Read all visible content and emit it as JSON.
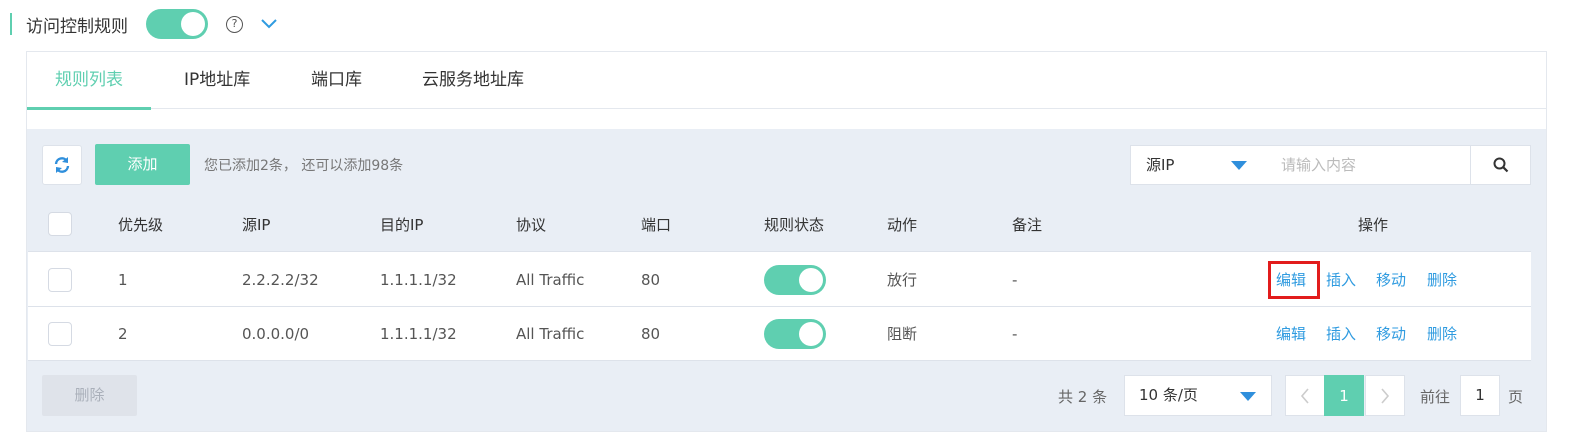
{
  "header": {
    "title": "访问控制规则",
    "enabled": true,
    "help_icon": "question-circle-icon",
    "expand_icon": "chevron-down-icon"
  },
  "tabs": [
    {
      "label": "规则列表",
      "active": true
    },
    {
      "label": "IP地址库",
      "active": false
    },
    {
      "label": "端口库",
      "active": false
    },
    {
      "label": "云服务地址库",
      "active": false
    }
  ],
  "toolbar": {
    "refresh_icon": "refresh-icon",
    "add_label": "添加",
    "hint": "您已添加2条， 还可以添加98条",
    "filter_value": "源IP",
    "search_placeholder": "请输入内容",
    "search_icon": "search-icon"
  },
  "table": {
    "headers": {
      "priority": "优先级",
      "src_ip": "源IP",
      "dst_ip": "目的IP",
      "protocol": "协议",
      "port": "端口",
      "status": "规则状态",
      "action": "动作",
      "note": "备注",
      "ops": "操作"
    },
    "rows": [
      {
        "priority": "1",
        "src_ip": "2.2.2.2/32",
        "dst_ip": "1.1.1.1/32",
        "protocol": "All Traffic",
        "port": "80",
        "status_on": true,
        "action": "放行",
        "note": "-",
        "edit": "编辑",
        "insert": "插入",
        "move": "移动",
        "delete": "删除"
      },
      {
        "priority": "2",
        "src_ip": "0.0.0.0/0",
        "dst_ip": "1.1.1.1/32",
        "protocol": "All Traffic",
        "port": "80",
        "status_on": true,
        "action": "阻断",
        "note": "-",
        "edit": "编辑",
        "insert": "插入",
        "move": "移动",
        "delete": "删除"
      }
    ]
  },
  "footer": {
    "delete_label": "删除",
    "total": "共 2 条",
    "page_size": "10 条/页",
    "current_page": "1",
    "goto_label": "前往",
    "goto_value": "1",
    "page_unit": "页"
  },
  "colors": {
    "accent": "#5fcfb0",
    "link": "#2f9be0",
    "highlight": "#e21c1c"
  }
}
